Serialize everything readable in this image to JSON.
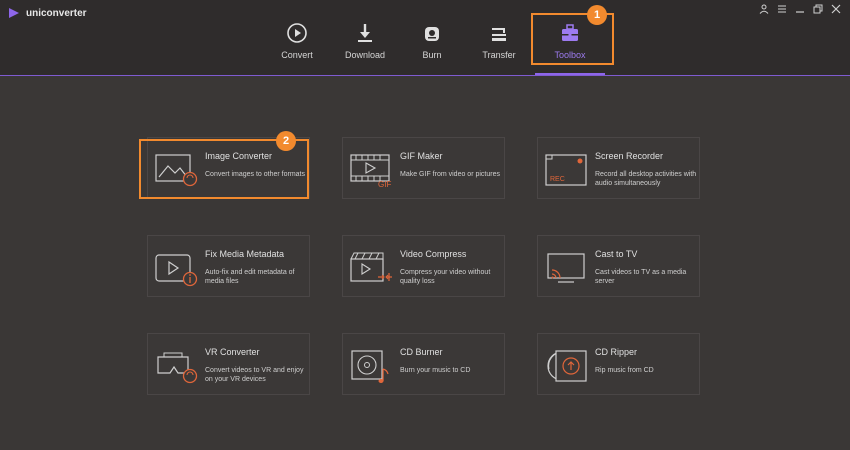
{
  "app": {
    "name": "uniconverter"
  },
  "colors": {
    "accent": "#8e66ea",
    "highlight": "#f28a2e",
    "background": "#3a3736",
    "topbar": "#2f2c2c"
  },
  "window_controls": [
    {
      "icon": "user-icon"
    },
    {
      "icon": "menu-icon"
    },
    {
      "icon": "minimize-icon"
    },
    {
      "icon": "restore-icon"
    },
    {
      "icon": "close-icon"
    }
  ],
  "nav": {
    "active": "Toolbox",
    "items": [
      {
        "label": "Convert",
        "icon": "convert-icon"
      },
      {
        "label": "Download",
        "icon": "download-icon"
      },
      {
        "label": "Burn",
        "icon": "burn-icon"
      },
      {
        "label": "Transfer",
        "icon": "transfer-icon"
      },
      {
        "label": "Toolbox",
        "icon": "toolbox-icon"
      }
    ]
  },
  "callouts": {
    "step1": "1",
    "step2": "2"
  },
  "tools": [
    {
      "title": "Image Converter",
      "desc": "Convert images to other formats",
      "icon": "image-converter-icon"
    },
    {
      "title": "GIF Maker",
      "desc": "Make GIF from video or pictures",
      "icon": "gif-maker-icon"
    },
    {
      "title": "Screen Recorder",
      "desc": "Record all desktop activities with audio simultaneously",
      "icon": "screen-recorder-icon"
    },
    {
      "title": "Fix Media Metadata",
      "desc": "Auto-fix and edit metadata of media files",
      "icon": "metadata-icon"
    },
    {
      "title": "Video Compress",
      "desc": "Compress your video without quality loss",
      "icon": "video-compress-icon"
    },
    {
      "title": "Cast to TV",
      "desc": "Cast videos to TV as a media server",
      "icon": "cast-tv-icon"
    },
    {
      "title": "VR Converter",
      "desc": "Convert videos to VR and enjoy on your VR devices",
      "icon": "vr-converter-icon"
    },
    {
      "title": "CD Burner",
      "desc": "Burn your music to CD",
      "icon": "cd-burner-icon"
    },
    {
      "title": "CD Ripper",
      "desc": "Rip music from CD",
      "icon": "cd-ripper-icon"
    }
  ],
  "icon_text": {
    "gif": "GIF",
    "rec": "REC"
  }
}
